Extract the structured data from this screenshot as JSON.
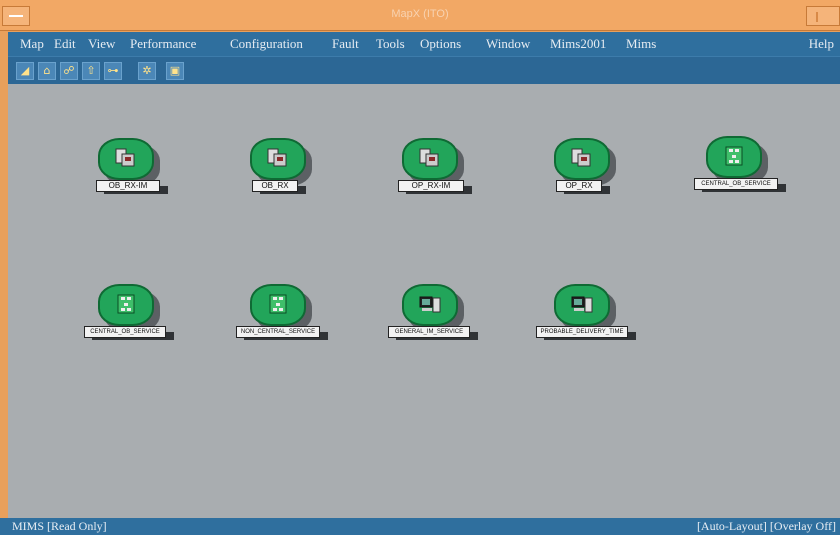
{
  "window": {
    "title": "MapX (ITO)",
    "colors": {
      "frame": "#f2a865",
      "menubar": "#2f6f9e",
      "canvas": "#a9adb0",
      "node": "#22a55a"
    }
  },
  "menu": [
    {
      "label": "Map"
    },
    {
      "label": "Edit"
    },
    {
      "label": "View"
    },
    {
      "label": "Performance"
    },
    {
      "label": "Configuration"
    },
    {
      "label": "Fault"
    },
    {
      "label": "Tools"
    },
    {
      "label": "Options"
    },
    {
      "label": "Window"
    },
    {
      "label": "Mims2001"
    },
    {
      "label": "Mims"
    }
  ],
  "help_label": "Help",
  "toolbar": [
    {
      "icon": "chart-icon"
    },
    {
      "icon": "home-icon"
    },
    {
      "icon": "network-icon"
    },
    {
      "icon": "up-arrow-icon"
    },
    {
      "icon": "tree-icon"
    },
    {
      "icon": "gear-icon"
    },
    {
      "icon": "map-icon"
    }
  ],
  "nodes": [
    {
      "label": "OB_RX-IM",
      "kind": "server"
    },
    {
      "label": "OB_RX",
      "kind": "server"
    },
    {
      "label": "OP_RX-IM",
      "kind": "server"
    },
    {
      "label": "OP_RX",
      "kind": "server"
    },
    {
      "label": "CENTRAL_OB_SERVICE",
      "kind": "network"
    },
    {
      "label": "CENTRAL_OB_SERVICE",
      "kind": "network"
    },
    {
      "label": "NON_CENTRAL_SERVICE",
      "kind": "network"
    },
    {
      "label": "GENERAL_IM_SERVICE",
      "kind": "workstation"
    },
    {
      "label": "PROBABLE_DELIVERY_TIME",
      "kind": "workstation"
    }
  ],
  "status": {
    "left": "MIMS [Read Only]",
    "right": "[Auto-Layout] [Overlay Off]"
  }
}
